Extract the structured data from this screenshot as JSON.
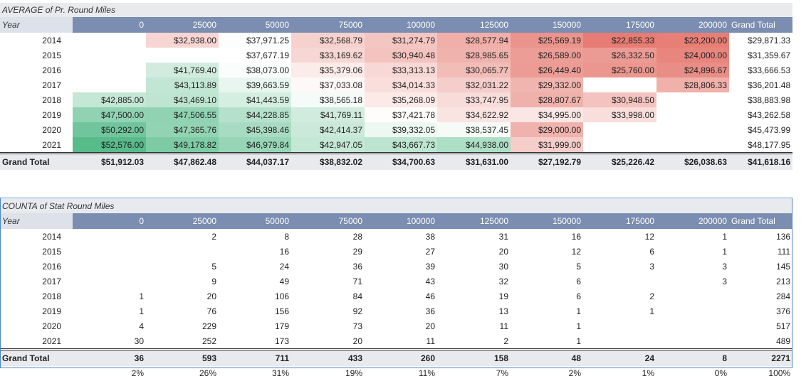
{
  "columns": [
    "0",
    "25000",
    "50000",
    "75000",
    "100000",
    "125000",
    "150000",
    "175000",
    "200000"
  ],
  "grand_total_header": "Grand Total",
  "year_header": "Year",
  "pivot1": {
    "title": "AVERAGE of Pr. Round Miles",
    "rows": [
      {
        "year": "2014",
        "cells": [
          "",
          "$32,938.00",
          "$37,971.25",
          "$32,568.79",
          "$31,274.79",
          "$28,577.94",
          "$25,569.19",
          "$22,855.33",
          "$23,200.00"
        ],
        "total": "$29,871.33"
      },
      {
        "year": "2015",
        "cells": [
          "",
          "",
          "$37,677.19",
          "$33,169.62",
          "$30,940.48",
          "$28,985.65",
          "$26,589.00",
          "$26,332.50",
          "$24,000.00"
        ],
        "total": "$31,359.67"
      },
      {
        "year": "2016",
        "cells": [
          "",
          "$41,769.40",
          "$38,073.00",
          "$35,379.06",
          "$33,313.13",
          "$30,065.77",
          "$26,449.40",
          "$25,760.00",
          "$24,896.67"
        ],
        "total": "$33,666.53"
      },
      {
        "year": "2017",
        "cells": [
          "",
          "$43,113.89",
          "$39,663.59",
          "$37,033.08",
          "$34,014.33",
          "$32,031.22",
          "$29,332.00",
          "",
          "$28,806.33"
        ],
        "total": "$36,201.48"
      },
      {
        "year": "2018",
        "cells": [
          "$42,885.00",
          "$43,469.10",
          "$41,443.59",
          "$38,565.18",
          "$35,268.09",
          "$33,747.95",
          "$28,807.67",
          "$30,948.50",
          ""
        ],
        "total": "$38,883.98"
      },
      {
        "year": "2019",
        "cells": [
          "$47,500.00",
          "$47,506.55",
          "$44,228.85",
          "$41,769.11",
          "$37,421.78",
          "$34,622.92",
          "$34,995.00",
          "$33,998.00",
          ""
        ],
        "total": "$43,262.58"
      },
      {
        "year": "2020",
        "cells": [
          "$50,292.00",
          "$47,365.76",
          "$45,398.46",
          "$42,414.37",
          "$39,332.05",
          "$38,537.45",
          "$29,000.00",
          "",
          ""
        ],
        "total": "$45,473.99"
      },
      {
        "year": "2021",
        "cells": [
          "$52,576.00",
          "$49,178.82",
          "$46,979.84",
          "$42,947.05",
          "$43,667.73",
          "$44,938.00",
          "$31,999.00",
          "",
          ""
        ],
        "total": "$48,177.95"
      }
    ],
    "grand_total_label": "Grand Total",
    "grand_total": [
      "$51,912.03",
      "$47,862.48",
      "$44,037.17",
      "$38,832.02",
      "$34,700.63",
      "$31,631.00",
      "$27,192.79",
      "$25,226.42",
      "$26,038.63"
    ],
    "grand_total_all": "$41,618.16",
    "heat": {
      "low_color": "#e67c73",
      "mid_color": "#ffffff",
      "high_color": "#57bb8a",
      "min": 22855.33,
      "mid": 37700,
      "max": 52576.0,
      "values": [
        [
          null,
          32938.0,
          37971.25,
          32568.79,
          31274.79,
          28577.94,
          25569.19,
          22855.33,
          23200.0
        ],
        [
          null,
          null,
          37677.19,
          33169.62,
          30940.48,
          28985.65,
          26589.0,
          26332.5,
          24000.0
        ],
        [
          null,
          41769.4,
          38073.0,
          35379.06,
          33313.13,
          30065.77,
          26449.4,
          25760.0,
          24896.67
        ],
        [
          null,
          43113.89,
          39663.59,
          37033.08,
          34014.33,
          32031.22,
          29332.0,
          null,
          28806.33
        ],
        [
          42885.0,
          43469.1,
          41443.59,
          38565.18,
          35268.09,
          33747.95,
          28807.67,
          30948.5,
          null
        ],
        [
          47500.0,
          47506.55,
          44228.85,
          41769.11,
          37421.78,
          34622.92,
          34995.0,
          33998.0,
          null
        ],
        [
          50292.0,
          47365.76,
          45398.46,
          42414.37,
          39332.05,
          38537.45,
          29000.0,
          null,
          null
        ],
        [
          52576.0,
          49178.82,
          46979.84,
          42947.05,
          43667.73,
          44938.0,
          31999.0,
          null,
          null
        ]
      ]
    }
  },
  "pivot2": {
    "title": "COUNTA of Stat Round Miles",
    "rows": [
      {
        "year": "2014",
        "cells": [
          "",
          "2",
          "8",
          "28",
          "38",
          "31",
          "16",
          "12",
          "1"
        ],
        "total": "136"
      },
      {
        "year": "2015",
        "cells": [
          "",
          "",
          "16",
          "29",
          "27",
          "20",
          "12",
          "6",
          "1"
        ],
        "total": "111"
      },
      {
        "year": "2016",
        "cells": [
          "",
          "5",
          "24",
          "36",
          "39",
          "30",
          "5",
          "3",
          "3"
        ],
        "total": "145"
      },
      {
        "year": "2017",
        "cells": [
          "",
          "9",
          "49",
          "71",
          "43",
          "32",
          "6",
          "",
          "3"
        ],
        "total": "213"
      },
      {
        "year": "2018",
        "cells": [
          "1",
          "20",
          "106",
          "84",
          "46",
          "19",
          "6",
          "2",
          ""
        ],
        "total": "284"
      },
      {
        "year": "2019",
        "cells": [
          "1",
          "76",
          "156",
          "92",
          "36",
          "13",
          "1",
          "1",
          ""
        ],
        "total": "376"
      },
      {
        "year": "2020",
        "cells": [
          "4",
          "229",
          "179",
          "73",
          "20",
          "11",
          "1",
          "",
          ""
        ],
        "total": "517"
      },
      {
        "year": "2021",
        "cells": [
          "30",
          "252",
          "173",
          "20",
          "11",
          "2",
          "1",
          "",
          ""
        ],
        "total": "489"
      }
    ],
    "grand_total_label": "Grand Total",
    "grand_total": [
      "36",
      "593",
      "711",
      "433",
      "260",
      "158",
      "48",
      "24",
      "8"
    ],
    "grand_total_all": "2271",
    "percents": [
      "2%",
      "26%",
      "31%",
      "19%",
      "11%",
      "7%",
      "2%",
      "1%",
      "0%"
    ],
    "percent_total": "100%"
  }
}
